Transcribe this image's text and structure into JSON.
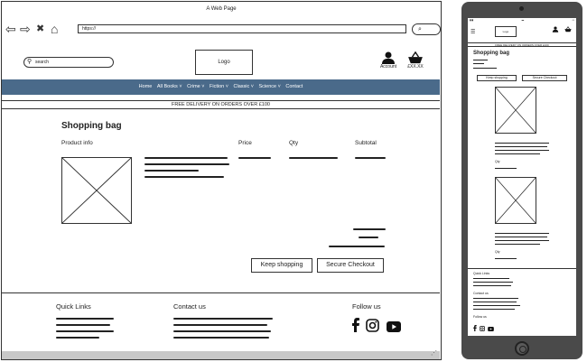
{
  "browser": {
    "window_title": "A Web Page",
    "url": "https://",
    "nav_back_glyph": "⇦",
    "nav_forward_glyph": "⇨",
    "nav_stop_glyph": "✖",
    "nav_home_glyph": "⌂",
    "search_glyph": "⌕"
  },
  "header": {
    "search_placeholder": "search",
    "logo": "Logo",
    "account_label": "Account",
    "basket_label": "£XX.XX"
  },
  "nav": {
    "items": [
      "Home",
      "All Books ˅",
      "Crime ˅",
      "Fiction ˅",
      "Classic ˅",
      "Science ˅",
      "Contact"
    ]
  },
  "delivery_banner": "FREE DELIVERY ON ORDERS OVER £100",
  "cart": {
    "title": "Shopping bag",
    "columns": [
      "Product info",
      "Price",
      "Qty",
      "Subtotal"
    ],
    "keep_shopping": "Keep shopping",
    "secure_checkout": "Secure Checkout"
  },
  "footer": {
    "quick_links": "Quick Links",
    "contact": "Contact us",
    "follow": "Follow us",
    "social_icons": [
      "facebook-icon",
      "instagram-icon",
      "youtube-icon"
    ]
  },
  "mobile": {
    "logo": "Logo",
    "delivery_banner": "FREE DELIVERY ON ORDERS OVER £100",
    "title": "Shopping bag",
    "keep_shopping": "Keep shopping",
    "secure_checkout": "Secure Checkout",
    "qty_label": "Qty",
    "quick_links": "Quick Links",
    "contact": "Contact us",
    "follow": "Follow us"
  },
  "colors": {
    "nav_background": "#4a6a8a",
    "phone_body": "#4a4a4a",
    "status_bar": "#c8c8c8"
  }
}
